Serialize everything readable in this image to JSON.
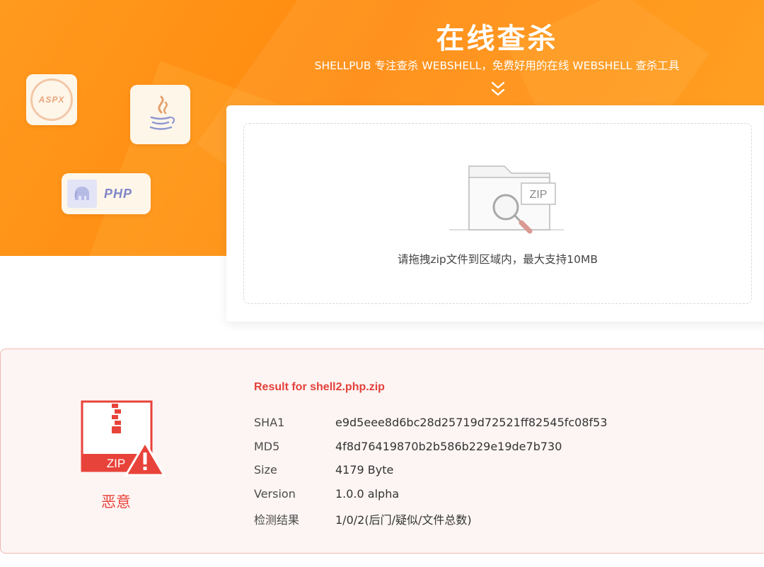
{
  "header": {
    "title": "在线查杀",
    "subtitle": "SHELLPUB 专注查杀 WEBSHELL，免费好用的在线 WEBSHELL 查杀工具"
  },
  "badges": {
    "aspx_label": "ASPX",
    "php_label": "PHP"
  },
  "upload": {
    "file_tag": "ZIP",
    "hint": "请拖拽zip文件到区域内，最大支持10MB"
  },
  "result": {
    "title": "Result for shell2.php.zip",
    "zip_tag": "ZIP",
    "status": "恶意",
    "rows": [
      {
        "label": "SHA1",
        "value": "e9d5eee8d6bc28d25719d72521ff82545fc08f53"
      },
      {
        "label": "MD5",
        "value": "4f8d76419870b2b586b229e19de7b730"
      },
      {
        "label": "Size",
        "value": "4179 Byte"
      },
      {
        "label": "Version",
        "value": "1.0.0 alpha"
      },
      {
        "label": "检测结果",
        "value": "1/0/2(后门/疑似/文件总数)"
      }
    ]
  },
  "colors": {
    "brand_orange": "#ff8c12",
    "danger_red": "#e8433a"
  }
}
